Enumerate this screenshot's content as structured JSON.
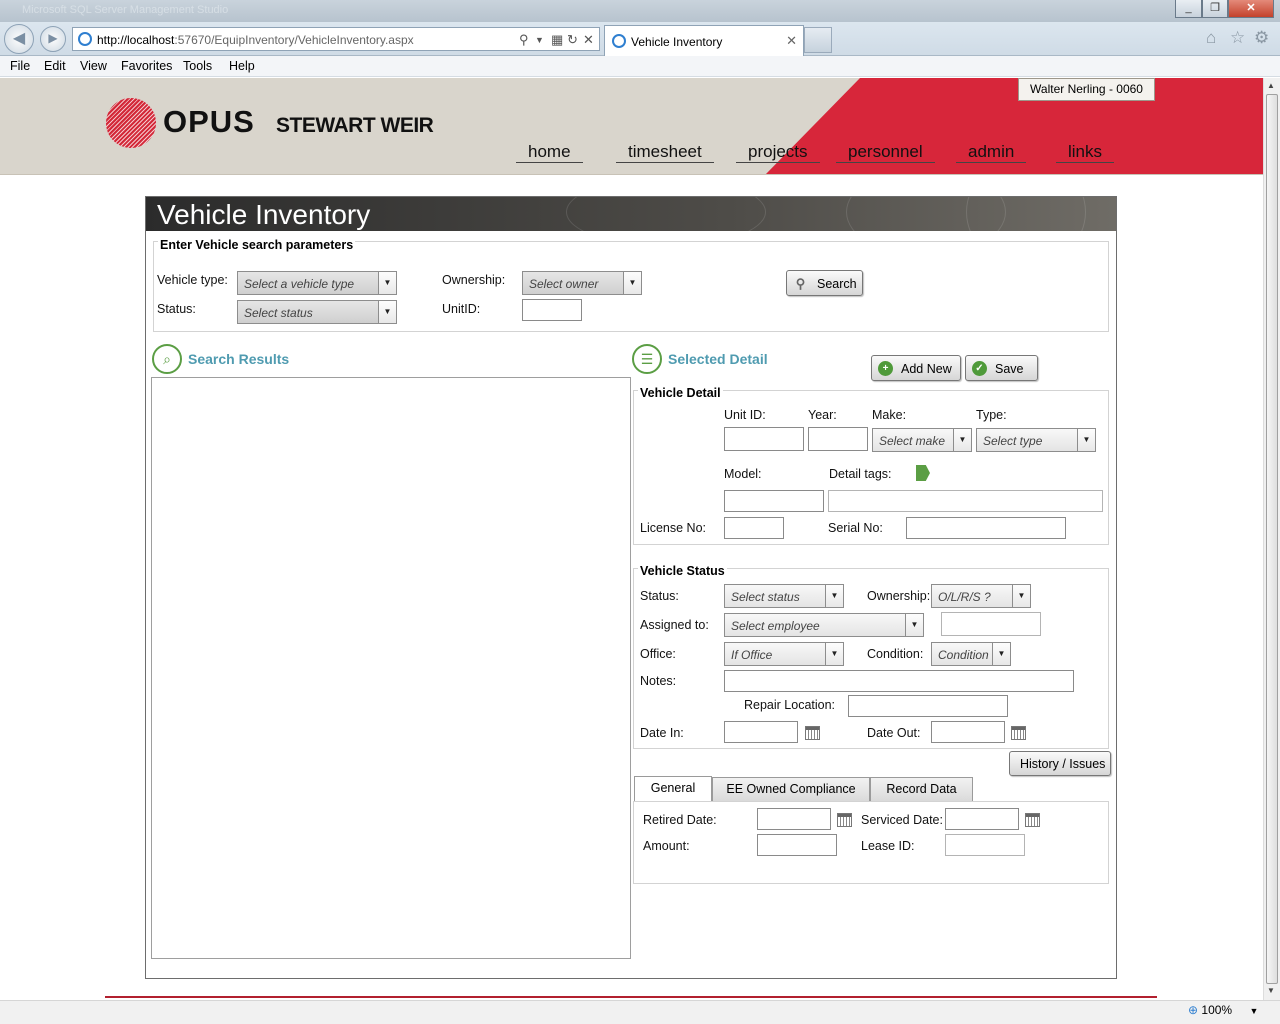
{
  "browser": {
    "window_title": "Microsoft SQL Server Management Studio",
    "url_host": "http://localhost",
    "url_rest": ":57670/EquipInventory/VehicleInventory.aspx",
    "tab_title": "Vehicle Inventory",
    "menu": [
      "File",
      "Edit",
      "View",
      "Favorites",
      "Tools",
      "Help"
    ],
    "zoom": "100%"
  },
  "header": {
    "logo_primary": "OPUS",
    "logo_secondary": "STEWART WEIR",
    "user": "Walter Nerling - 0060",
    "nav": [
      "home",
      "timesheet",
      "projects",
      "personnel",
      "admin",
      "links"
    ],
    "accent": "#d7263a"
  },
  "page": {
    "title": "Vehicle Inventory"
  },
  "search": {
    "legend": "Enter Vehicle search parameters",
    "vehicle_type_label": "Vehicle type:",
    "vehicle_type_value": "Select a vehicle type",
    "status_label": "Status:",
    "status_value": "Select status",
    "ownership_label": "Ownership:",
    "ownership_value": "Select owner",
    "unitid_label": "UnitID:",
    "search_button": "Search"
  },
  "results": {
    "title": "Search Results"
  },
  "detail": {
    "title": "Selected Detail",
    "add_button": "Add New",
    "save_button": "Save",
    "vehicle_detail": {
      "legend": "Vehicle Detail",
      "unit_id_label": "Unit ID:",
      "year_label": "Year:",
      "make_label": "Make:",
      "make_value": "Select make",
      "type_label": "Type:",
      "type_value": "Select type",
      "model_label": "Model:",
      "tags_label": "Detail tags:",
      "license_label": "License No:",
      "serial_label": "Serial No:"
    },
    "vehicle_status": {
      "legend": "Vehicle Status",
      "status_label": "Status:",
      "status_value": "Select status",
      "ownership_label": "Ownership:",
      "ownership_value": "O/L/R/S ?",
      "assigned_label": "Assigned to:",
      "assigned_value": "Select employee",
      "office_label": "Office:",
      "office_value": "If Office",
      "condition_label": "Condition:",
      "condition_value": "Condition",
      "notes_label": "Notes:",
      "repair_label": "Repair Location:",
      "date_in_label": "Date In:",
      "date_out_label": "Date Out:"
    },
    "history_button": "History / Issues",
    "tabs": [
      "General",
      "EE Owned Compliance",
      "Record Data"
    ],
    "general": {
      "retired_label": "Retired Date:",
      "serviced_label": "Serviced Date:",
      "amount_label": "Amount:",
      "lease_label": "Lease ID:"
    }
  }
}
